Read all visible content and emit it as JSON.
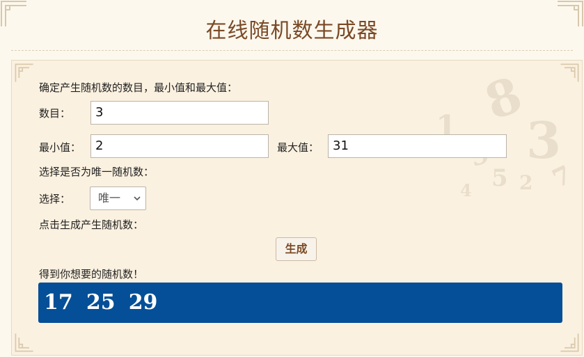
{
  "page": {
    "title": "在线随机数生成器"
  },
  "form": {
    "intro_text": "确定产生随机数的数目，最小值和最大值：",
    "count_label": "数目：",
    "count_value": "3",
    "min_label": "最小值：",
    "min_value": "2",
    "max_label": "最大值：",
    "max_value": "31",
    "unique_prompt": "选择是否为唯一随机数：",
    "select_label": "选择：",
    "select_value": "唯一",
    "generate_prompt": "点击生成产生随机数：",
    "generate_button": "生成",
    "result_prompt": "得到你想要的随机数！"
  },
  "result": {
    "numbers": [
      "17",
      "25",
      "29"
    ]
  },
  "colors": {
    "background": "#fdf8ee",
    "panel": "#fbf1e0",
    "title": "#7a4a26",
    "result_bg": "#044f97",
    "result_text": "#ffffff"
  },
  "icons": {
    "corner": "ornament-corner-icon",
    "select": "chevron-down-icon",
    "watermark": "numbers-watermark-icon"
  }
}
